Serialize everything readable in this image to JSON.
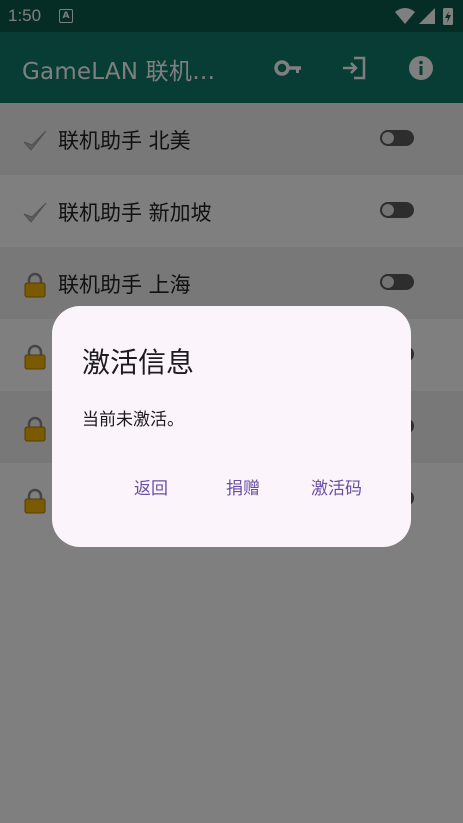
{
  "status_bar": {
    "time": "1:50",
    "notification_icon": "A",
    "icons": [
      "wifi-icon",
      "signal-icon",
      "battery-charging-icon"
    ]
  },
  "app_bar": {
    "title": "GameLAN 联机…",
    "actions": [
      "key-icon",
      "login-icon",
      "info-icon"
    ],
    "color": "#0f7b69"
  },
  "list": {
    "items": [
      {
        "label": "联机助手 北美",
        "icon": "checkmark-icon"
      },
      {
        "label": "联机助手 新加坡",
        "icon": "checkmark-icon"
      },
      {
        "label": "联机助手 上海",
        "icon": "lock-icon"
      },
      {
        "label": "",
        "icon": "lock-icon"
      },
      {
        "label": "",
        "icon": "lock-icon"
      },
      {
        "label": "",
        "icon": "lock-icon"
      }
    ]
  },
  "dialog": {
    "title": "激活信息",
    "message": "当前未激活。",
    "buttons": {
      "back": "返回",
      "donate": "捐赠",
      "activation_code": "激活码"
    },
    "button_color": "#6750a4"
  }
}
